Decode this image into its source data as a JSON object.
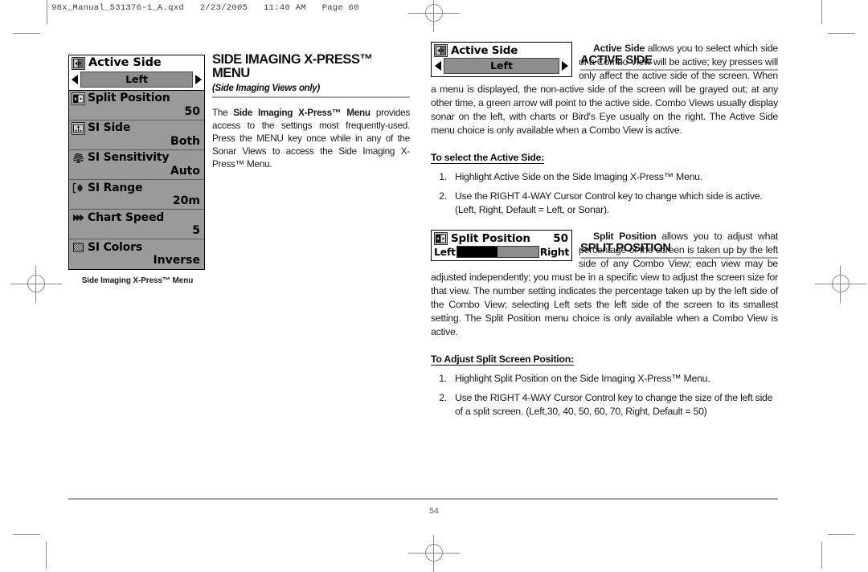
{
  "print_slug": "98x_Manual_531376-1_A.qxd   2/23/2005   11:40 AM   Page 60",
  "footer": {
    "page_number": "54"
  },
  "left_menu": {
    "caption": "Side Imaging X-Press™ Menu",
    "header": {
      "icon": "active-side-icon",
      "title": "Active Side",
      "selected_value": "Left",
      "left_arrow": "left-arrow-icon",
      "right_arrow": "right-arrow-icon"
    },
    "rows": [
      {
        "icon": "split-position-icon",
        "label": "Split Position",
        "value": "50"
      },
      {
        "icon": "si-side-icon",
        "label": "SI Side",
        "value": "Both"
      },
      {
        "icon": "si-sensitivity-icon",
        "label": "SI Sensitivity",
        "value": "Auto"
      },
      {
        "icon": "si-range-icon",
        "label": "SI Range",
        "value": "20m"
      },
      {
        "icon": "chart-speed-icon",
        "label": "Chart Speed",
        "value": "5"
      },
      {
        "icon": "si-colors-icon",
        "label": "SI Colors",
        "value": "Inverse"
      }
    ]
  },
  "middle_column": {
    "heading": "SIDE IMAGING X-PRESS™ MENU",
    "subheading": "(Side Imaging Views only)",
    "paragraph_lead": "The ",
    "paragraph_bold": "Side Imaging X-Press™ Menu",
    "paragraph_rest": " provides access to the settings most frequently-used. Press the MENU key once while in any of the Sonar Views to access the Side Imaging X-Press™ Menu."
  },
  "active_side_section": {
    "heading": "ACTIVE SIDE",
    "widget": {
      "icon": "active-side-icon",
      "title": "Active Side",
      "selected_value": "Left",
      "left_arrow": "left-arrow-icon",
      "right_arrow": "right-arrow-icon"
    },
    "paragraph_bold": "Active Side",
    "paragraph_rest": " allows you to select which side of a Combo View will be active; key presses will only affect the active side of the screen. When a menu is displayed, the non-active side of the screen will be grayed out; at any other time, a green arrow will point to the active side. Combo Views usually display sonar on the left, with charts or Bird's Eye usually on the right. The Active Side menu choice is only available when a Combo View is active.",
    "procedure_title": "To select the Active Side:",
    "steps": [
      {
        "num": "1.",
        "text": "Highlight Active Side on the Side Imaging X-Press™ Menu."
      },
      {
        "num": "2.",
        "text": "Use the RIGHT 4-WAY Cursor Control key to change which side is active. (Left, Right, Default = Left, or Sonar)."
      }
    ]
  },
  "split_position_section": {
    "heading": "SPLIT POSITION",
    "widget": {
      "icon": "split-position-icon",
      "title": "Split Position",
      "value": "50",
      "left_label": "Left",
      "right_label": "Right",
      "fill_percent": 50
    },
    "paragraph_bold": "Split Position",
    "paragraph_rest": " allows you to adjust what percentage of the screen is taken up by the left side of any Combo View; each view may be adjusted independently; you must be in a specific view to adjust the screen size for that view. The number setting indicates the percentage taken up by the left side of the Combo View; selecting Left sets the left side of the screen to its smallest setting. The Split Position menu choice is only available when a Combo View is active.",
    "procedure_title": "To Adjust Split Screen Position:",
    "steps": [
      {
        "num": "1.",
        "text": "Highlight Split Position on the Side Imaging X-Press™ Menu."
      },
      {
        "num": "2.",
        "text": "Use the RIGHT 4-WAY Cursor Control key to change the size of the left side of a split screen. (Left,30, 40, 50, 60, 70, Right, Default = 50)"
      }
    ]
  },
  "colors": {
    "rule": "#a8a8a8",
    "lcd_background": "#9a9a9a",
    "lcd_highlight": "#8d8d8d",
    "text": "#1a1a1a",
    "crop_mark": "#8a8a8a"
  }
}
